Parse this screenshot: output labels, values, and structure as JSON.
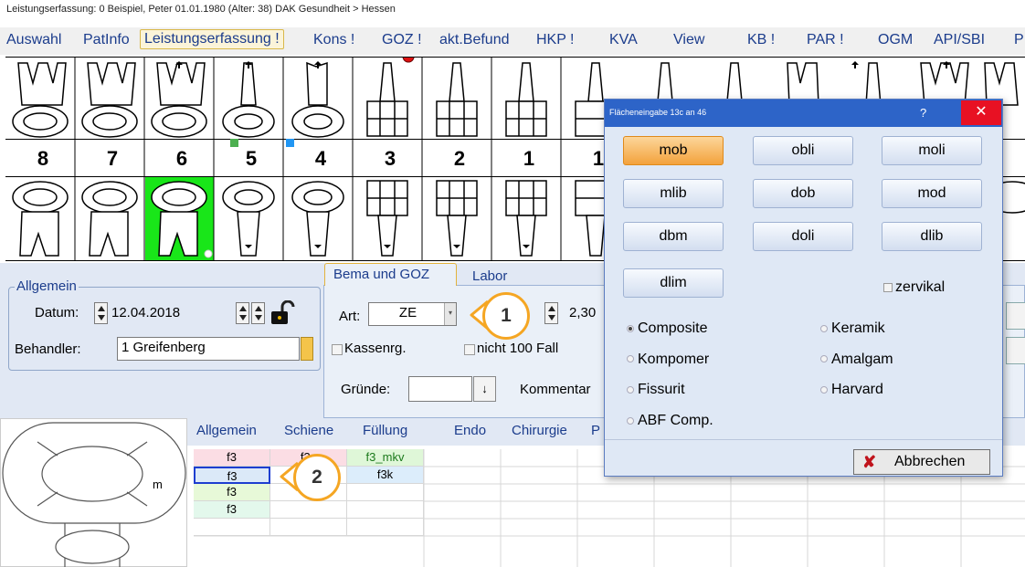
{
  "window": {
    "title": "Leistungserfassung: 0  Beispiel, Peter  01.01.1980 (Alter: 38)  DAK Gesundheit > Hessen"
  },
  "menu": [
    "Auswahl",
    "PatInfo",
    "Leistungserfassung !",
    "Kons !",
    "GOZ !",
    "akt.Befund",
    "HKP !",
    "KVA",
    "View",
    "KB !",
    "PAR !",
    "OGM",
    "API/SBI",
    "P"
  ],
  "chart": {
    "tooth_numbers": [
      "8",
      "7",
      "6",
      "5",
      "4",
      "3",
      "2",
      "1",
      "1"
    ],
    "highlight_color": "#19e619"
  },
  "allgemein": {
    "legend": "Allgemein",
    "datum_label": "Datum:",
    "datum_value": "12.04.2018",
    "behandler_label": "Behandler:",
    "behandler_value": "1 Greifenberg"
  },
  "tabs": {
    "bema_goz": "Bema und GOZ",
    "labor": "Labor"
  },
  "bema": {
    "art_label": "Art:",
    "art_value": "ZE",
    "faktor_value": "2,30",
    "kassenrg": "Kassenrg.",
    "nicht100": "nicht 100 Fall",
    "gruende_label": "Gründe:",
    "kommentar_label": "Kommentar"
  },
  "lower_tabs": [
    "Allgemein",
    "Schiene",
    "Füllung",
    "Endo",
    "Chirurgie",
    "P"
  ],
  "tooth_diagram": {
    "label": "m"
  },
  "grid": {
    "rows": [
      [
        "f3",
        "f3c",
        "f3_mkv"
      ],
      [
        "f3",
        "",
        "f3k"
      ],
      [
        "f3",
        "",
        ""
      ],
      [
        "f3",
        "",
        ""
      ],
      [
        "",
        "",
        ""
      ]
    ]
  },
  "dialog": {
    "title": "Flächeneingabe 13c an 46",
    "help": "?",
    "close": "✕",
    "surface_buttons": [
      "mob",
      "obli",
      "moli",
      "mlib",
      "dob",
      "mod",
      "dbm",
      "doli",
      "dlib",
      "dlim"
    ],
    "zervikal": "zervikal",
    "materials": [
      "Composite",
      "Keramik",
      "Kompomer",
      "Amalgam",
      "Fissurit",
      "Harvard",
      "ABF Comp."
    ],
    "selected_material": "Composite",
    "cancel": "Abbrechen"
  },
  "callouts": [
    "1",
    "2"
  ],
  "colors": {
    "accent": "#f5a623",
    "menu_text": "#1b3c8c",
    "dialog_title": "#2d64c8",
    "selected_button": "#f3a23c"
  }
}
